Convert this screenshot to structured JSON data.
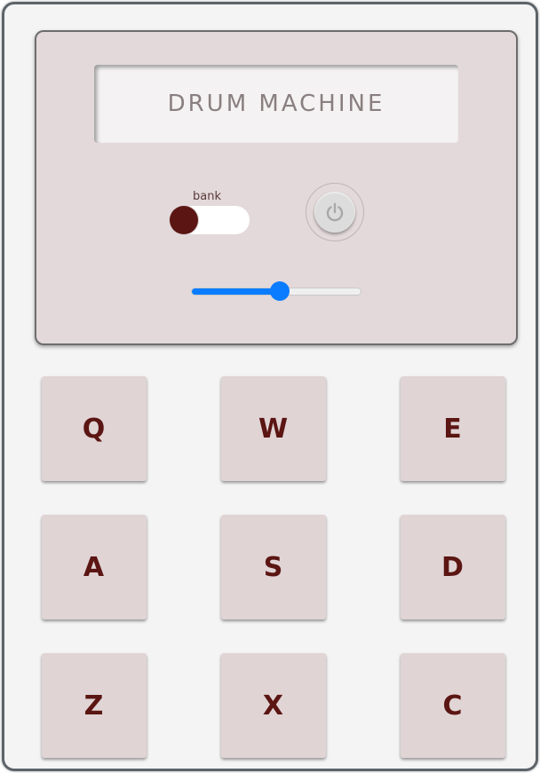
{
  "display": {
    "text": "DRUM MACHINE"
  },
  "controls": {
    "bank_label": "bank",
    "bank_on": false,
    "power_icon": "power-icon",
    "volume_fraction": 0.52
  },
  "pads": [
    "Q",
    "W",
    "E",
    "A",
    "S",
    "D",
    "Z",
    "X",
    "C"
  ],
  "colors": {
    "panel": "#e3d9da",
    "pad": "#e0d4d5",
    "pad_text": "#5b1512",
    "toggle_knob": "#5b1512",
    "slider_accent": "#0a7cff",
    "frame_border": "#5e6469"
  }
}
